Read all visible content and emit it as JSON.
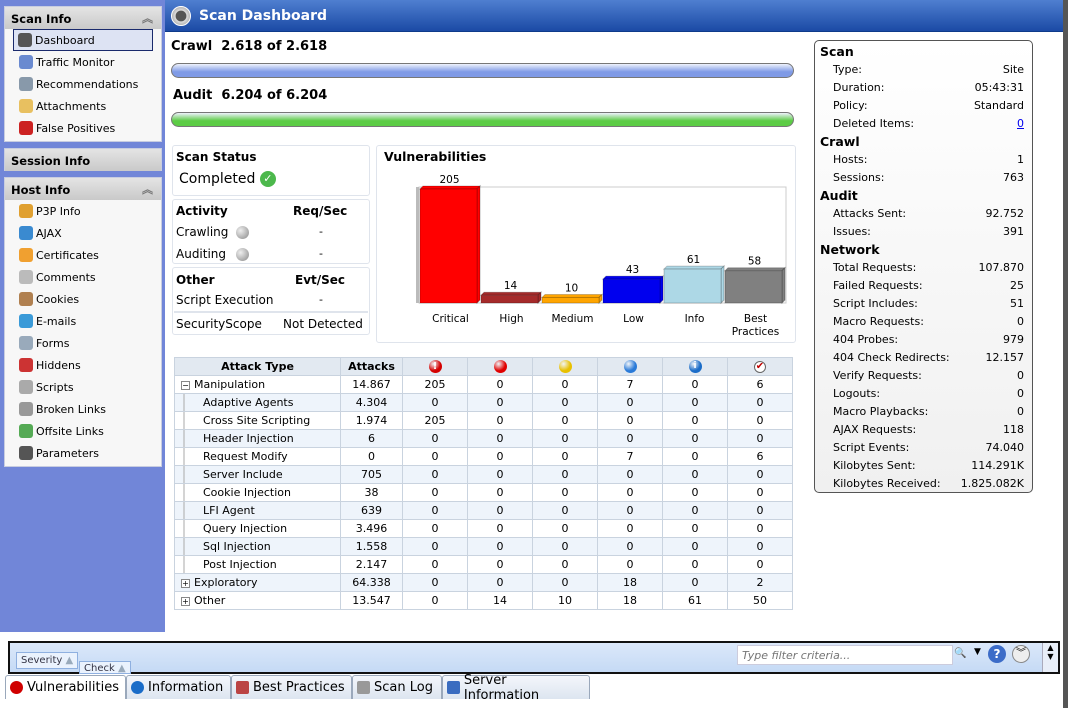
{
  "sidebar": {
    "scan_info": {
      "title": "Scan Info",
      "items": [
        {
          "label": "Dashboard",
          "icon": "dashboard-icon"
        },
        {
          "label": "Traffic Monitor",
          "icon": "traffic-monitor-icon"
        },
        {
          "label": "Recommendations",
          "icon": "recommendations-icon"
        },
        {
          "label": "Attachments",
          "icon": "attachments-icon"
        },
        {
          "label": "False Positives",
          "icon": "bug-warning-icon"
        }
      ]
    },
    "session_info": {
      "title": "Session Info"
    },
    "host_info": {
      "title": "Host Info",
      "items": [
        {
          "label": "P3P Info",
          "icon": "p3p-icon"
        },
        {
          "label": "AJAX",
          "icon": "ajax-icon"
        },
        {
          "label": "Certificates",
          "icon": "certificate-icon"
        },
        {
          "label": "Comments",
          "icon": "comment-icon"
        },
        {
          "label": "Cookies",
          "icon": "cookie-icon"
        },
        {
          "label": "E-mails",
          "icon": "email-icon"
        },
        {
          "label": "Forms",
          "icon": "form-icon"
        },
        {
          "label": "Hiddens",
          "icon": "hidden-eye-icon"
        },
        {
          "label": "Scripts",
          "icon": "script-icon"
        },
        {
          "label": "Broken Links",
          "icon": "broken-link-icon"
        },
        {
          "label": "Offsite Links",
          "icon": "offsite-link-icon"
        },
        {
          "label": "Parameters",
          "icon": "parameters-icon"
        }
      ]
    }
  },
  "header": {
    "title": "Scan Dashboard"
  },
  "progress": {
    "crawl": {
      "label": "Crawl",
      "text": "2.618 of 2.618",
      "percent": 100,
      "color": "#7f9ae6"
    },
    "audit": {
      "label": "Audit",
      "text": "6.204 of 6.204",
      "percent": 100,
      "color": "#5ccc45"
    }
  },
  "status": {
    "title": "Scan Status",
    "value": "Completed"
  },
  "activity": {
    "title": "Activity",
    "col": "Req/Sec",
    "rows": [
      {
        "label": "Crawling",
        "value": "-"
      },
      {
        "label": "Auditing",
        "value": "-"
      }
    ]
  },
  "other": {
    "title": "Other",
    "col": "Evt/Sec",
    "rows": [
      {
        "label": "Script Execution",
        "value": "-"
      }
    ]
  },
  "securityscope": {
    "label": "SecurityScope",
    "value": "Not Detected"
  },
  "chart_data": {
    "type": "bar",
    "title": "Vulnerabilities",
    "categories": [
      "Critical",
      "High",
      "Medium",
      "Low",
      "Info",
      "Best Practices"
    ],
    "values": [
      205,
      14,
      10,
      43,
      61,
      58
    ],
    "colors": [
      "#ff0000",
      "#a52a2a",
      "#ffa500",
      "#0000ee",
      "#add8e6",
      "#808080"
    ],
    "ylim": [
      0,
      205
    ],
    "grid": false
  },
  "table": {
    "headers": [
      "Attack Type",
      "Attacks"
    ],
    "severity_icons": [
      {
        "name": "critical-icon",
        "color": "#d40000"
      },
      {
        "name": "high-icon",
        "color": "#e00000"
      },
      {
        "name": "medium-icon",
        "color": "#e8c000"
      },
      {
        "name": "low-icon",
        "color": "#2a7ad8"
      },
      {
        "name": "info-icon",
        "color": "#1a6cc8"
      },
      {
        "name": "best-practice-icon",
        "color": "#c00000"
      }
    ],
    "rows": [
      {
        "name": "Manipulation",
        "level": 0,
        "expander": "−",
        "values": [
          "14.867",
          "205",
          "0",
          "0",
          "7",
          "0",
          "6"
        ]
      },
      {
        "name": "Adaptive Agents",
        "level": 1,
        "values": [
          "4.304",
          "0",
          "0",
          "0",
          "0",
          "0",
          "0"
        ]
      },
      {
        "name": "Cross Site Scripting",
        "level": 1,
        "values": [
          "1.974",
          "205",
          "0",
          "0",
          "0",
          "0",
          "0"
        ]
      },
      {
        "name": "Header Injection",
        "level": 1,
        "values": [
          "6",
          "0",
          "0",
          "0",
          "0",
          "0",
          "0"
        ]
      },
      {
        "name": "Request Modify",
        "level": 1,
        "values": [
          "0",
          "0",
          "0",
          "0",
          "7",
          "0",
          "6"
        ]
      },
      {
        "name": "Server Include",
        "level": 1,
        "values": [
          "705",
          "0",
          "0",
          "0",
          "0",
          "0",
          "0"
        ]
      },
      {
        "name": "Cookie Injection",
        "level": 1,
        "values": [
          "38",
          "0",
          "0",
          "0",
          "0",
          "0",
          "0"
        ]
      },
      {
        "name": "LFI Agent",
        "level": 1,
        "values": [
          "639",
          "0",
          "0",
          "0",
          "0",
          "0",
          "0"
        ]
      },
      {
        "name": "Query Injection",
        "level": 1,
        "values": [
          "3.496",
          "0",
          "0",
          "0",
          "0",
          "0",
          "0"
        ]
      },
      {
        "name": "Sql Injection",
        "level": 1,
        "values": [
          "1.558",
          "0",
          "0",
          "0",
          "0",
          "0",
          "0"
        ]
      },
      {
        "name": "Post Injection",
        "level": 1,
        "values": [
          "2.147",
          "0",
          "0",
          "0",
          "0",
          "0",
          "0"
        ]
      },
      {
        "name": "Exploratory",
        "level": 0,
        "expander": "+",
        "values": [
          "64.338",
          "0",
          "0",
          "0",
          "18",
          "0",
          "2"
        ]
      },
      {
        "name": "Other",
        "level": 0,
        "expander": "+",
        "values": [
          "13.547",
          "0",
          "14",
          "10",
          "18",
          "61",
          "50"
        ]
      }
    ]
  },
  "summary": {
    "sections": [
      {
        "title": "Scan",
        "items": [
          {
            "k": "Type:",
            "v": "Site"
          },
          {
            "k": "Duration:",
            "v": "05:43:31"
          },
          {
            "k": "Policy:",
            "v": "Standard"
          },
          {
            "k": "Deleted Items:",
            "v": "0",
            "link": true
          }
        ]
      },
      {
        "title": "Crawl",
        "items": [
          {
            "k": "Hosts:",
            "v": "1"
          },
          {
            "k": "Sessions:",
            "v": "763"
          }
        ]
      },
      {
        "title": "Audit",
        "items": [
          {
            "k": "Attacks Sent:",
            "v": "92.752"
          },
          {
            "k": "Issues:",
            "v": "391"
          }
        ]
      },
      {
        "title": "Network",
        "items": [
          {
            "k": "Total Requests:",
            "v": "107.870"
          },
          {
            "k": "Failed Requests:",
            "v": "25"
          },
          {
            "k": "Script Includes:",
            "v": "51"
          },
          {
            "k": "Macro Requests:",
            "v": "0"
          },
          {
            "k": "404 Probes:",
            "v": "979"
          },
          {
            "k": "404 Check Redirects:",
            "v": "12.157"
          },
          {
            "k": "Verify Requests:",
            "v": "0"
          },
          {
            "k": "Logouts:",
            "v": "0"
          },
          {
            "k": "Macro Playbacks:",
            "v": "0"
          },
          {
            "k": "AJAX Requests:",
            "v": "118"
          },
          {
            "k": "Script Events:",
            "v": "74.040"
          },
          {
            "k": "Kilobytes Sent:",
            "v": "114.291K"
          },
          {
            "k": "Kilobytes Received:",
            "v": "1.825.082K"
          }
        ]
      }
    ]
  },
  "bottom": {
    "group_chips": [
      "Severity",
      "Check"
    ],
    "filter_placeholder": "Type filter criteria...",
    "tabs": [
      {
        "label": "Vulnerabilities",
        "color": "#d00000"
      },
      {
        "label": "Information",
        "color": "#1a6cc8"
      },
      {
        "label": "Best Practices",
        "color": "#b44"
      },
      {
        "label": "Scan Log",
        "color": "#999"
      },
      {
        "label": "Server Information",
        "color": "#3a6cc0"
      }
    ]
  }
}
